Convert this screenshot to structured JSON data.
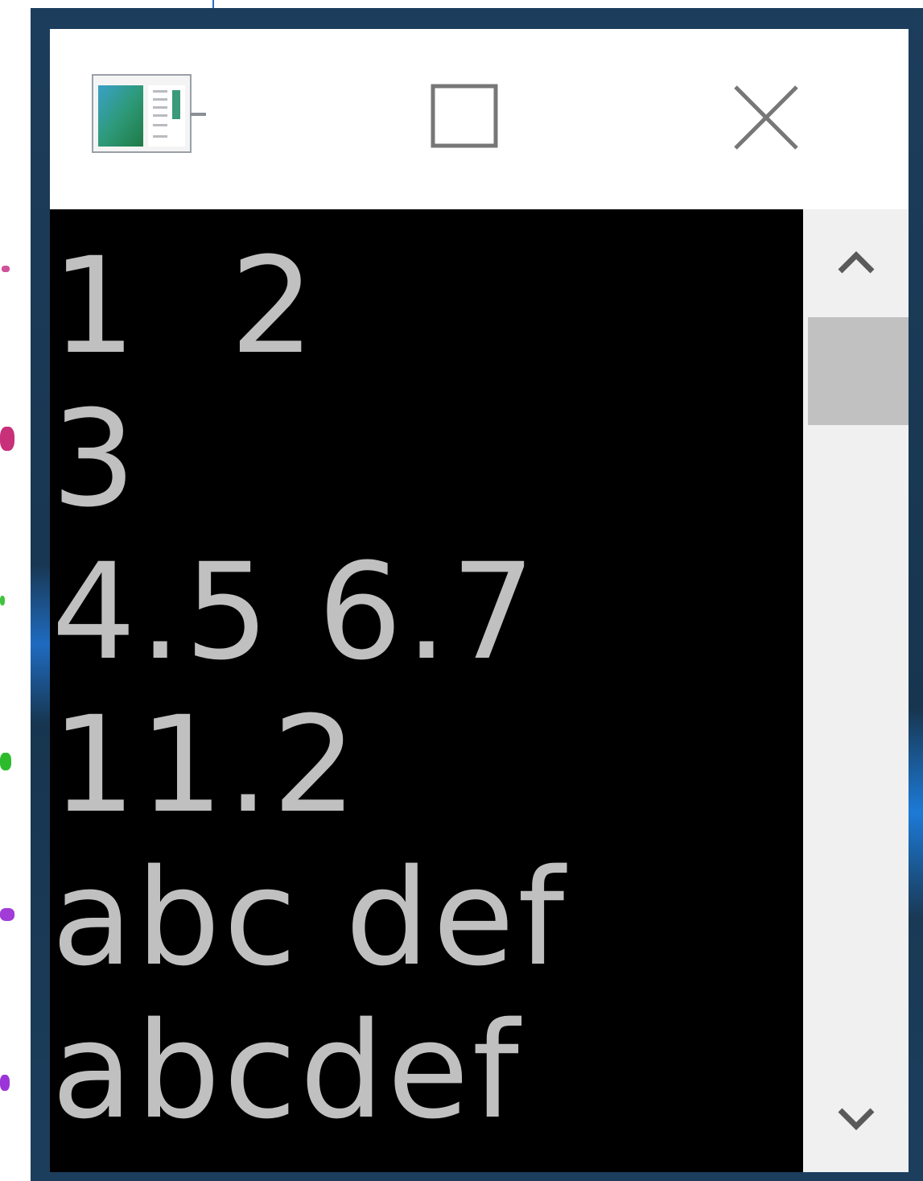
{
  "window": {
    "icon": "console-window-icon",
    "buttons": {
      "maximize_icon": "maximize-icon",
      "close_icon": "close-icon"
    }
  },
  "console": {
    "lines": [
      "1  2",
      "3",
      "4.5 6.7",
      "11.2",
      "abc def",
      "abcdef"
    ],
    "text_color": "#c0c0c0",
    "background_color": "#000000"
  },
  "scrollbar": {
    "up_icon": "chevron-up-icon",
    "down_icon": "chevron-down-icon"
  }
}
